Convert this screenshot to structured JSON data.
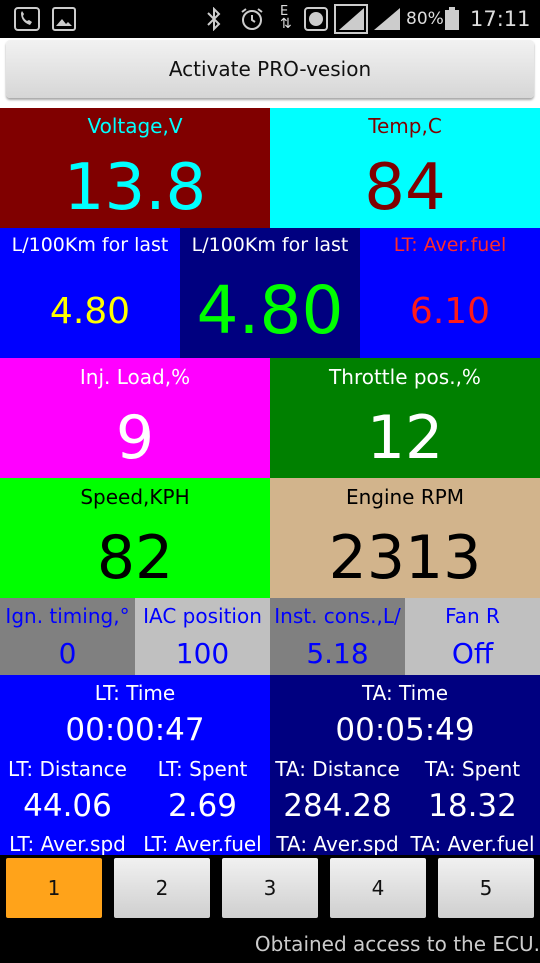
{
  "status_bar": {
    "battery": "80%",
    "time": "17:11",
    "network_letter": "E"
  },
  "top": {
    "activate_button": "Activate PRO-vesion"
  },
  "colors": {
    "voltage_bg": "#800000",
    "voltage_fg": "#00ffff",
    "temp_bg": "#00ffff",
    "temp_fg": "#800000",
    "fuel_bg": "#0000ff",
    "fuel_center_bg": "#000080",
    "injload_bg": "#ff00ff",
    "throttle_bg": "#008000",
    "speed_bg": "#00ff00",
    "rpm_bg": "#d2b48c",
    "tab_active": "#ffa31a"
  },
  "gauges": {
    "voltage": {
      "label": "Voltage,V",
      "value": "13.8"
    },
    "temp": {
      "label": "Temp,C",
      "value": "84"
    },
    "fuel_left": {
      "label": "L/100Km for last",
      "value": "4.80"
    },
    "fuel_center": {
      "label": "L/100Km for last",
      "value": "4.80"
    },
    "lt_aver_fuel_top": {
      "label": "LT: Aver.fuel",
      "value": "6.10"
    },
    "inj_load": {
      "label": "Inj. Load,%",
      "value": "9"
    },
    "throttle": {
      "label": "Throttle pos.,%",
      "value": "12"
    },
    "speed": {
      "label": "Speed,KPH",
      "value": "82"
    },
    "rpm": {
      "label": "Engine RPM",
      "value": "2313"
    },
    "ign_timing": {
      "label": "Ign. timing,°",
      "value": "0"
    },
    "iac": {
      "label": "IAC position",
      "value": "100"
    },
    "inst_cons": {
      "label": "Inst. cons.,L/",
      "value": "5.18"
    },
    "fan": {
      "label": "Fan R",
      "value": "Off"
    }
  },
  "trip": {
    "lt_time": {
      "label": "LT: Time",
      "value": "00:00:47"
    },
    "ta_time": {
      "label": "TA: Time",
      "value": "00:05:49"
    },
    "lt_distance": {
      "label": "LT: Distance",
      "value": "44.06"
    },
    "lt_spent": {
      "label": "LT: Spent",
      "value": "2.69"
    },
    "ta_distance": {
      "label": "TA: Distance",
      "value": "284.28"
    },
    "ta_spent": {
      "label": "TA: Spent",
      "value": "18.32"
    },
    "lt_aver_spd": {
      "label": "LT: Aver.spd"
    },
    "lt_aver_fuel": {
      "label": "LT: Aver.fuel"
    },
    "ta_aver_spd": {
      "label": "TA: Aver.spd"
    },
    "ta_aver_fuel": {
      "label": "TA: Aver.fuel"
    }
  },
  "tabs": [
    {
      "label": "1",
      "active": true
    },
    {
      "label": "2",
      "active": false
    },
    {
      "label": "3",
      "active": false
    },
    {
      "label": "4",
      "active": false
    },
    {
      "label": "5",
      "active": false
    }
  ],
  "footer": {
    "message": "Obtained access to the ECU."
  }
}
